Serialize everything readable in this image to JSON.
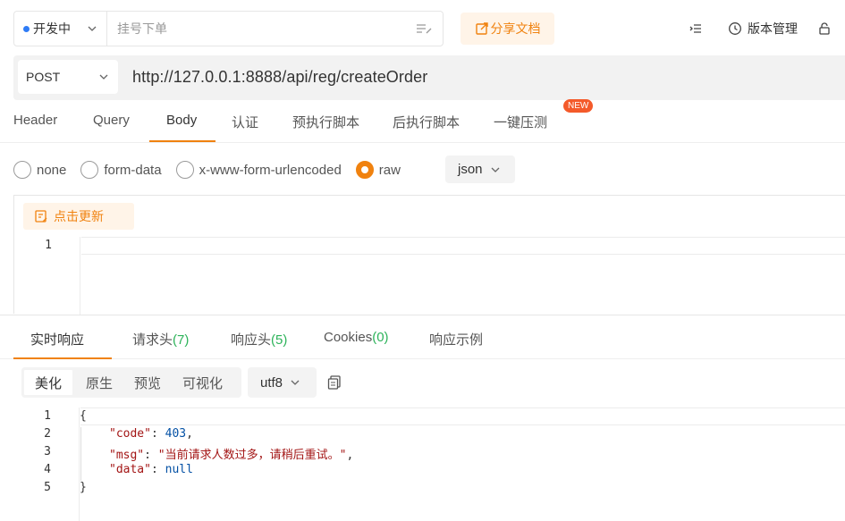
{
  "topbar": {
    "status": "开发中",
    "memo_placeholder": "挂号下单",
    "share_label": "分享文档",
    "version_label": "版本管理"
  },
  "request": {
    "method": "POST",
    "url": "http://127.0.0.1:8888/api/reg/createOrder"
  },
  "req_tabs": [
    {
      "label": "Header"
    },
    {
      "label": "Query"
    },
    {
      "label": "Body"
    },
    {
      "label": "认证"
    },
    {
      "label": "预执行脚本"
    },
    {
      "label": "后执行脚本"
    },
    {
      "label": "一键压测"
    }
  ],
  "active_req_tab": "Body",
  "new_badge": "NEW",
  "body_types": [
    "none",
    "form-data",
    "x-www-form-urlencoded",
    "raw"
  ],
  "selected_body_type": "raw",
  "raw_format": "json",
  "update_label": "点击更新",
  "request_editor": {
    "line_numbers": [
      "1"
    ]
  },
  "resp_tabs": [
    {
      "label": "实时响应",
      "count": ""
    },
    {
      "label": "请求头",
      "count": "(7)"
    },
    {
      "label": "响应头",
      "count": "(5)"
    },
    {
      "label": "Cookies",
      "count": "(0)"
    },
    {
      "label": "响应示例",
      "count": ""
    }
  ],
  "view_modes": [
    "美化",
    "原生",
    "预览",
    "可视化"
  ],
  "active_view_mode": "美化",
  "encoding": "utf8",
  "response": {
    "line_numbers": [
      "1",
      "2",
      "3",
      "4",
      "5"
    ],
    "open_brace": "{",
    "close_brace": "}",
    "fields": [
      {
        "key": "\"code\"",
        "value": "403",
        "suffix": ","
      },
      {
        "key": "\"msg\"",
        "value": "\"当前请求人数过多，请稍后重试。\"",
        "suffix": ","
      },
      {
        "key": "\"data\"",
        "value": "null",
        "suffix": ""
      }
    ]
  },
  "colors": {
    "accent": "#f0820f",
    "count_green": "#2db35a",
    "status_dot": "#2f7cf6",
    "badge_red": "#f45a2a"
  }
}
